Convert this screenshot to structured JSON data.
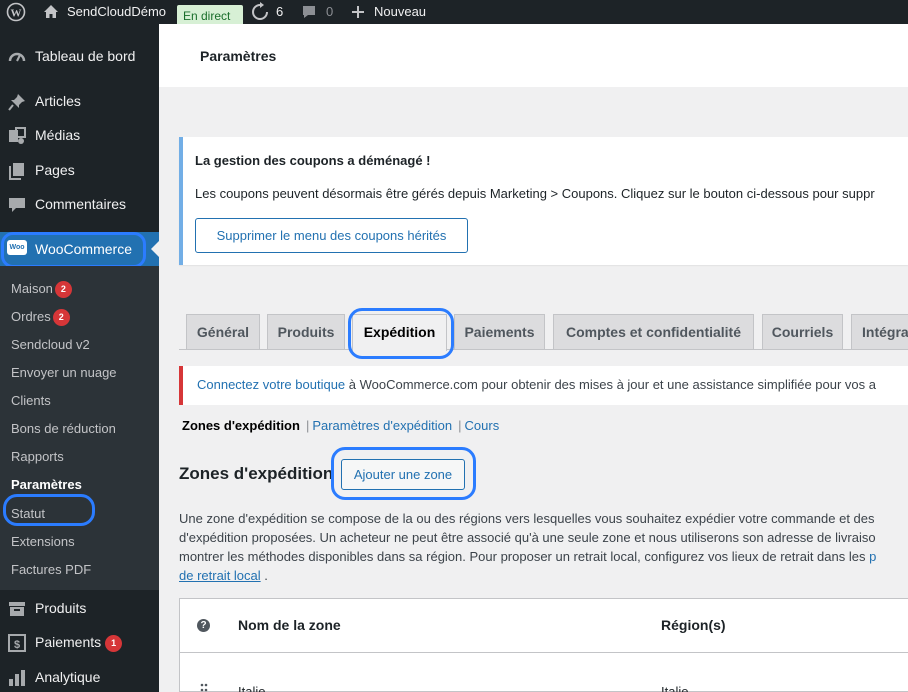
{
  "adminbar": {
    "site_name": "SendCloudDémo",
    "live_label": "En direct",
    "updates_count": "6",
    "comments_count": "0",
    "new_label": "Nouveau"
  },
  "sidebar": {
    "top_items": [
      {
        "label": "Tableau de bord",
        "icon": "dashboard-icon"
      },
      {
        "label": "Articles",
        "icon": "pin-icon"
      },
      {
        "label": "Médias",
        "icon": "media-icon"
      },
      {
        "label": "Pages",
        "icon": "pages-icon"
      },
      {
        "label": "Commentaires",
        "icon": "comment-icon"
      }
    ],
    "woocommerce_label": "WooCommerce",
    "woocommerce_logo_text": "Woo",
    "submenu": [
      {
        "label": "Maison",
        "badge": "2"
      },
      {
        "label": "Ordres",
        "badge": "2"
      },
      {
        "label": "Sendcloud v2"
      },
      {
        "label": "Envoyer un nuage"
      },
      {
        "label": "Clients"
      },
      {
        "label": "Bons de réduction"
      },
      {
        "label": "Rapports"
      },
      {
        "label": "Paramètres",
        "current": true
      },
      {
        "label": "Statut"
      },
      {
        "label": "Extensions"
      },
      {
        "label": "Factures PDF"
      }
    ],
    "bottom_items": [
      {
        "label": "Produits",
        "icon": "products-icon"
      },
      {
        "label": "Paiements",
        "icon": "payments-icon",
        "badge": "1"
      },
      {
        "label": "Analytique",
        "icon": "analytics-icon"
      }
    ]
  },
  "header": {
    "title": "Paramètres"
  },
  "notice": {
    "title": "La gestion des coupons a déménagé !",
    "text": "Les coupons peuvent désormais être gérés depuis Marketing > Coupons. Cliquez sur le bouton ci-dessous pour suppr",
    "button_label": "Supprimer le menu des coupons hérités"
  },
  "tabs": [
    {
      "label": "Général"
    },
    {
      "label": "Produits"
    },
    {
      "label": "Expédition",
      "active": true
    },
    {
      "label": "Paiements"
    },
    {
      "label": "Comptes et confidentialité"
    },
    {
      "label": "Courriels"
    },
    {
      "label": "Intégra"
    }
  ],
  "connect_notice": {
    "link": "Connectez votre boutique",
    "text": " à WooCommerce.com pour obtenir des mises à jour et une assistance simplifiée pour vos a"
  },
  "subnav": {
    "current": "Zones d'expédition",
    "options": "Paramètres d'expédition",
    "classes": "Cours"
  },
  "zones": {
    "title": "Zones d'expédition",
    "add_button": "Ajouter une zone",
    "desc_line1": "Une zone d'expédition se compose de la ou des régions vers lesquelles vous souhaitez expédier votre commande et des",
    "desc_line2": "d'expédition proposées. Un acheteur ne peut être associé qu'à une seule zone et nous utiliserons son adresse de livraiso",
    "desc_line3": "montrer les méthodes disponibles dans sa région. Pour proposer un retrait local, configurez vos lieux de retrait dans les ",
    "desc_line3_link": "p",
    "desc_line4_link": "de retrait local",
    "desc_line4_tail": " .",
    "table": {
      "help": "?",
      "col_name": "Nom de la zone",
      "col_region": "Région(s)",
      "row1_name": "Italie",
      "row1_region": "Italie"
    }
  },
  "colors": {
    "sidebar_bg": "#1d2327",
    "submenu_bg": "#2c3338",
    "accent": "#2271b1",
    "highlight_ring": "#2b7cff",
    "badge": "#d63638"
  }
}
